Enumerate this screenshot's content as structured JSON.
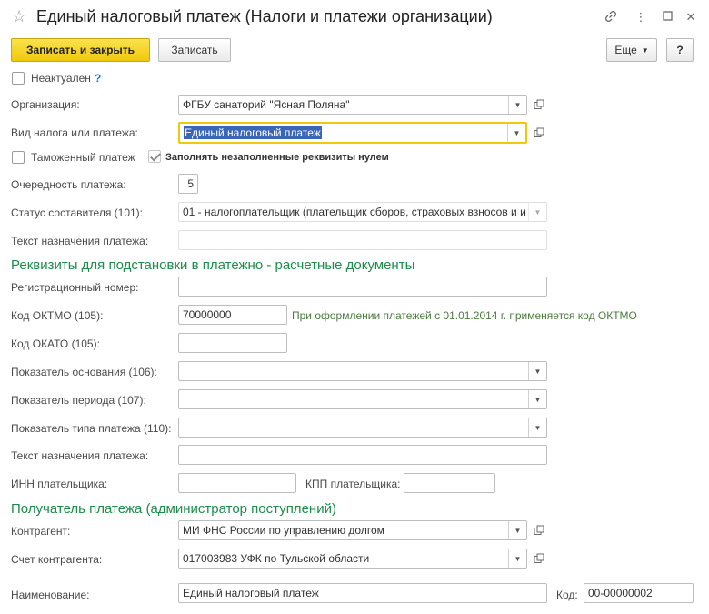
{
  "window": {
    "title": "Единый налоговый платеж (Налоги и платежи организации)"
  },
  "toolbar": {
    "save_close_label": "Записать и закрыть",
    "save_label": "Записать",
    "more_label": "Еще",
    "help_label": "?"
  },
  "form": {
    "inactive_label": "Неактуален",
    "inactive_help": "?",
    "organization_label": "Организация:",
    "organization_value": "ФГБУ санаторий \"Ясная Поляна\"",
    "tax_type_label": "Вид налога или платежа:",
    "tax_type_value": "Единый налоговый платеж",
    "customs_label": "Таможенный платеж",
    "fill_zero_label": "Заполнять незаполненные реквизиты нулем",
    "priority_label": "Очередность платежа:",
    "priority_value": "5",
    "status_label": "Статус составителя (101):",
    "status_value": "01 - налогоплательщик (плательщик сборов, страховых взносов и и",
    "purpose_label": "Текст назначения платежа:",
    "purpose_value": ""
  },
  "requisites": {
    "section_title": "Реквизиты для подстановки в платежно - расчетные документы",
    "reg_number_label": "Регистрационный номер:",
    "reg_number_value": "",
    "oktmo_label": "Код ОКТМО (105):",
    "oktmo_value": "70000000",
    "oktmo_hint": "При оформлении платежей с 01.01.2014 г. применяется код ОКТМО",
    "okato_label": "Код ОКАТО (105):",
    "okato_value": "",
    "basis_label": "Показатель основания (106):",
    "basis_value": "",
    "period_label": "Показатель периода (107):",
    "period_value": "",
    "type_label": "Показатель типа платежа (110):",
    "type_value": "",
    "purpose_label": "Текст назначения платежа:",
    "purpose_value": "",
    "inn_label": "ИНН плательщика:",
    "inn_value": "",
    "kpp_label": "КПП плательщика:",
    "kpp_value": ""
  },
  "recipient": {
    "section_title": "Получатель платежа (администратор поступлений)",
    "counterparty_label": "Контрагент:",
    "counterparty_value": "МИ ФНС России по управлению долгом",
    "account_label": "Счет контрагента:",
    "account_value": "017003983 УФК по Тульской области",
    "name_label": "Наименование:",
    "name_value": "Единый налоговый платеж",
    "code_label": "Код:",
    "code_value": "00-00000002"
  },
  "icons": {
    "star": "star-icon",
    "link": "link-icon",
    "menu": "more-vertical-icon",
    "maximize": "maximize-icon",
    "close": "close-icon",
    "dropdown": "chevron-down-icon",
    "open": "open-form-icon"
  },
  "colors": {
    "accent": "#f1c80b",
    "section": "#1e8c4a",
    "selection": "#3a66b7",
    "help": "#1e6fd0"
  }
}
